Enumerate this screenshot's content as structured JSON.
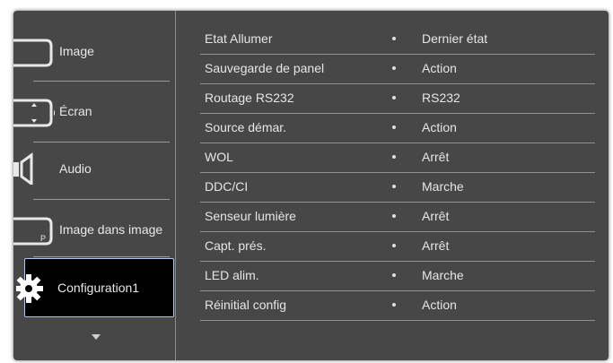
{
  "sidebar": {
    "items": [
      {
        "label": "Image",
        "icon": "image-frame-icon"
      },
      {
        "label": "Écran",
        "icon": "screen-adjust-icon"
      },
      {
        "label": "Audio",
        "icon": "speaker-icon"
      },
      {
        "label": "Image dans image",
        "icon": "picture-in-picture-icon",
        "icon_text": "P"
      },
      {
        "label": "Configuration1",
        "icon": "gear-icon",
        "selected": true
      }
    ],
    "more_icon": "chevron-down-icon"
  },
  "settings": {
    "rows": [
      {
        "name": "Etat Allumer",
        "value": "Dernier état"
      },
      {
        "name": "Sauvegarde de panel",
        "value": "Action"
      },
      {
        "name": "Routage RS232",
        "value": "RS232"
      },
      {
        "name": "Source démar.",
        "value": "Action"
      },
      {
        "name": "WOL",
        "value": "Arrêt"
      },
      {
        "name": "DDC/CI",
        "value": "Marche"
      },
      {
        "name": "Senseur lumière",
        "value": "Arrêt"
      },
      {
        "name": "Capt. prés.",
        "value": "Arrêt"
      },
      {
        "name": "LED alim.",
        "value": "Marche"
      },
      {
        "name": "Réinitial config",
        "value": "Action"
      }
    ]
  },
  "colors": {
    "panel": "#474747",
    "selected_bg": "#000000",
    "selected_border": "#a9c7f2",
    "text": "#e6e6e6"
  }
}
